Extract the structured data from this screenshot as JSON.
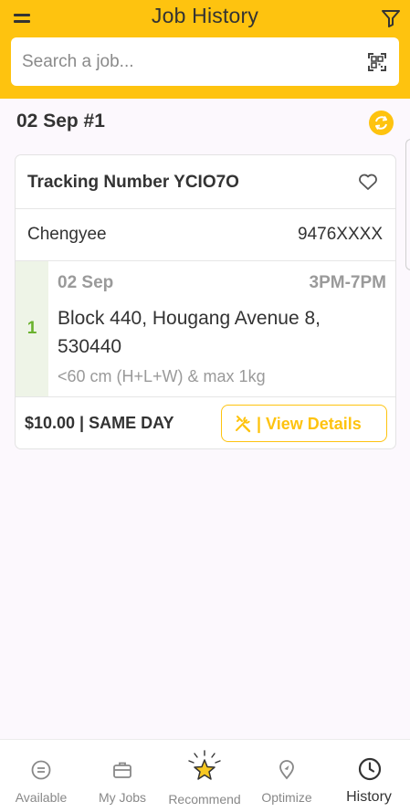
{
  "header": {
    "title": "Job History",
    "search_placeholder": "Search a job..."
  },
  "group": {
    "date_label": "02 Sep #1"
  },
  "job": {
    "tracking_label": "Tracking Number YCIO7O",
    "contact_name": "Chengyee",
    "contact_phone": "9476XXXX",
    "stop": {
      "number": "1",
      "date": "02 Sep",
      "time": "3PM-7PM",
      "address": "Block 440, Hougang Avenue 8, 530440",
      "size": "<60 cm (H+L+W) & max 1kg"
    },
    "price": "$10.00 | SAME DAY",
    "view_details_label": "| View Details"
  },
  "tabs": [
    {
      "label": "Available",
      "icon": "menu-circle-icon"
    },
    {
      "label": "My Jobs",
      "icon": "briefcase-icon"
    },
    {
      "label": "Recommend",
      "icon": "star-icon"
    },
    {
      "label": "Optimize",
      "icon": "route-pin-icon"
    },
    {
      "label": "History",
      "icon": "clock-icon"
    }
  ],
  "colors": {
    "accent": "#fec30f",
    "stop_green": "#6ab22e",
    "background": "#fcf8fd"
  }
}
